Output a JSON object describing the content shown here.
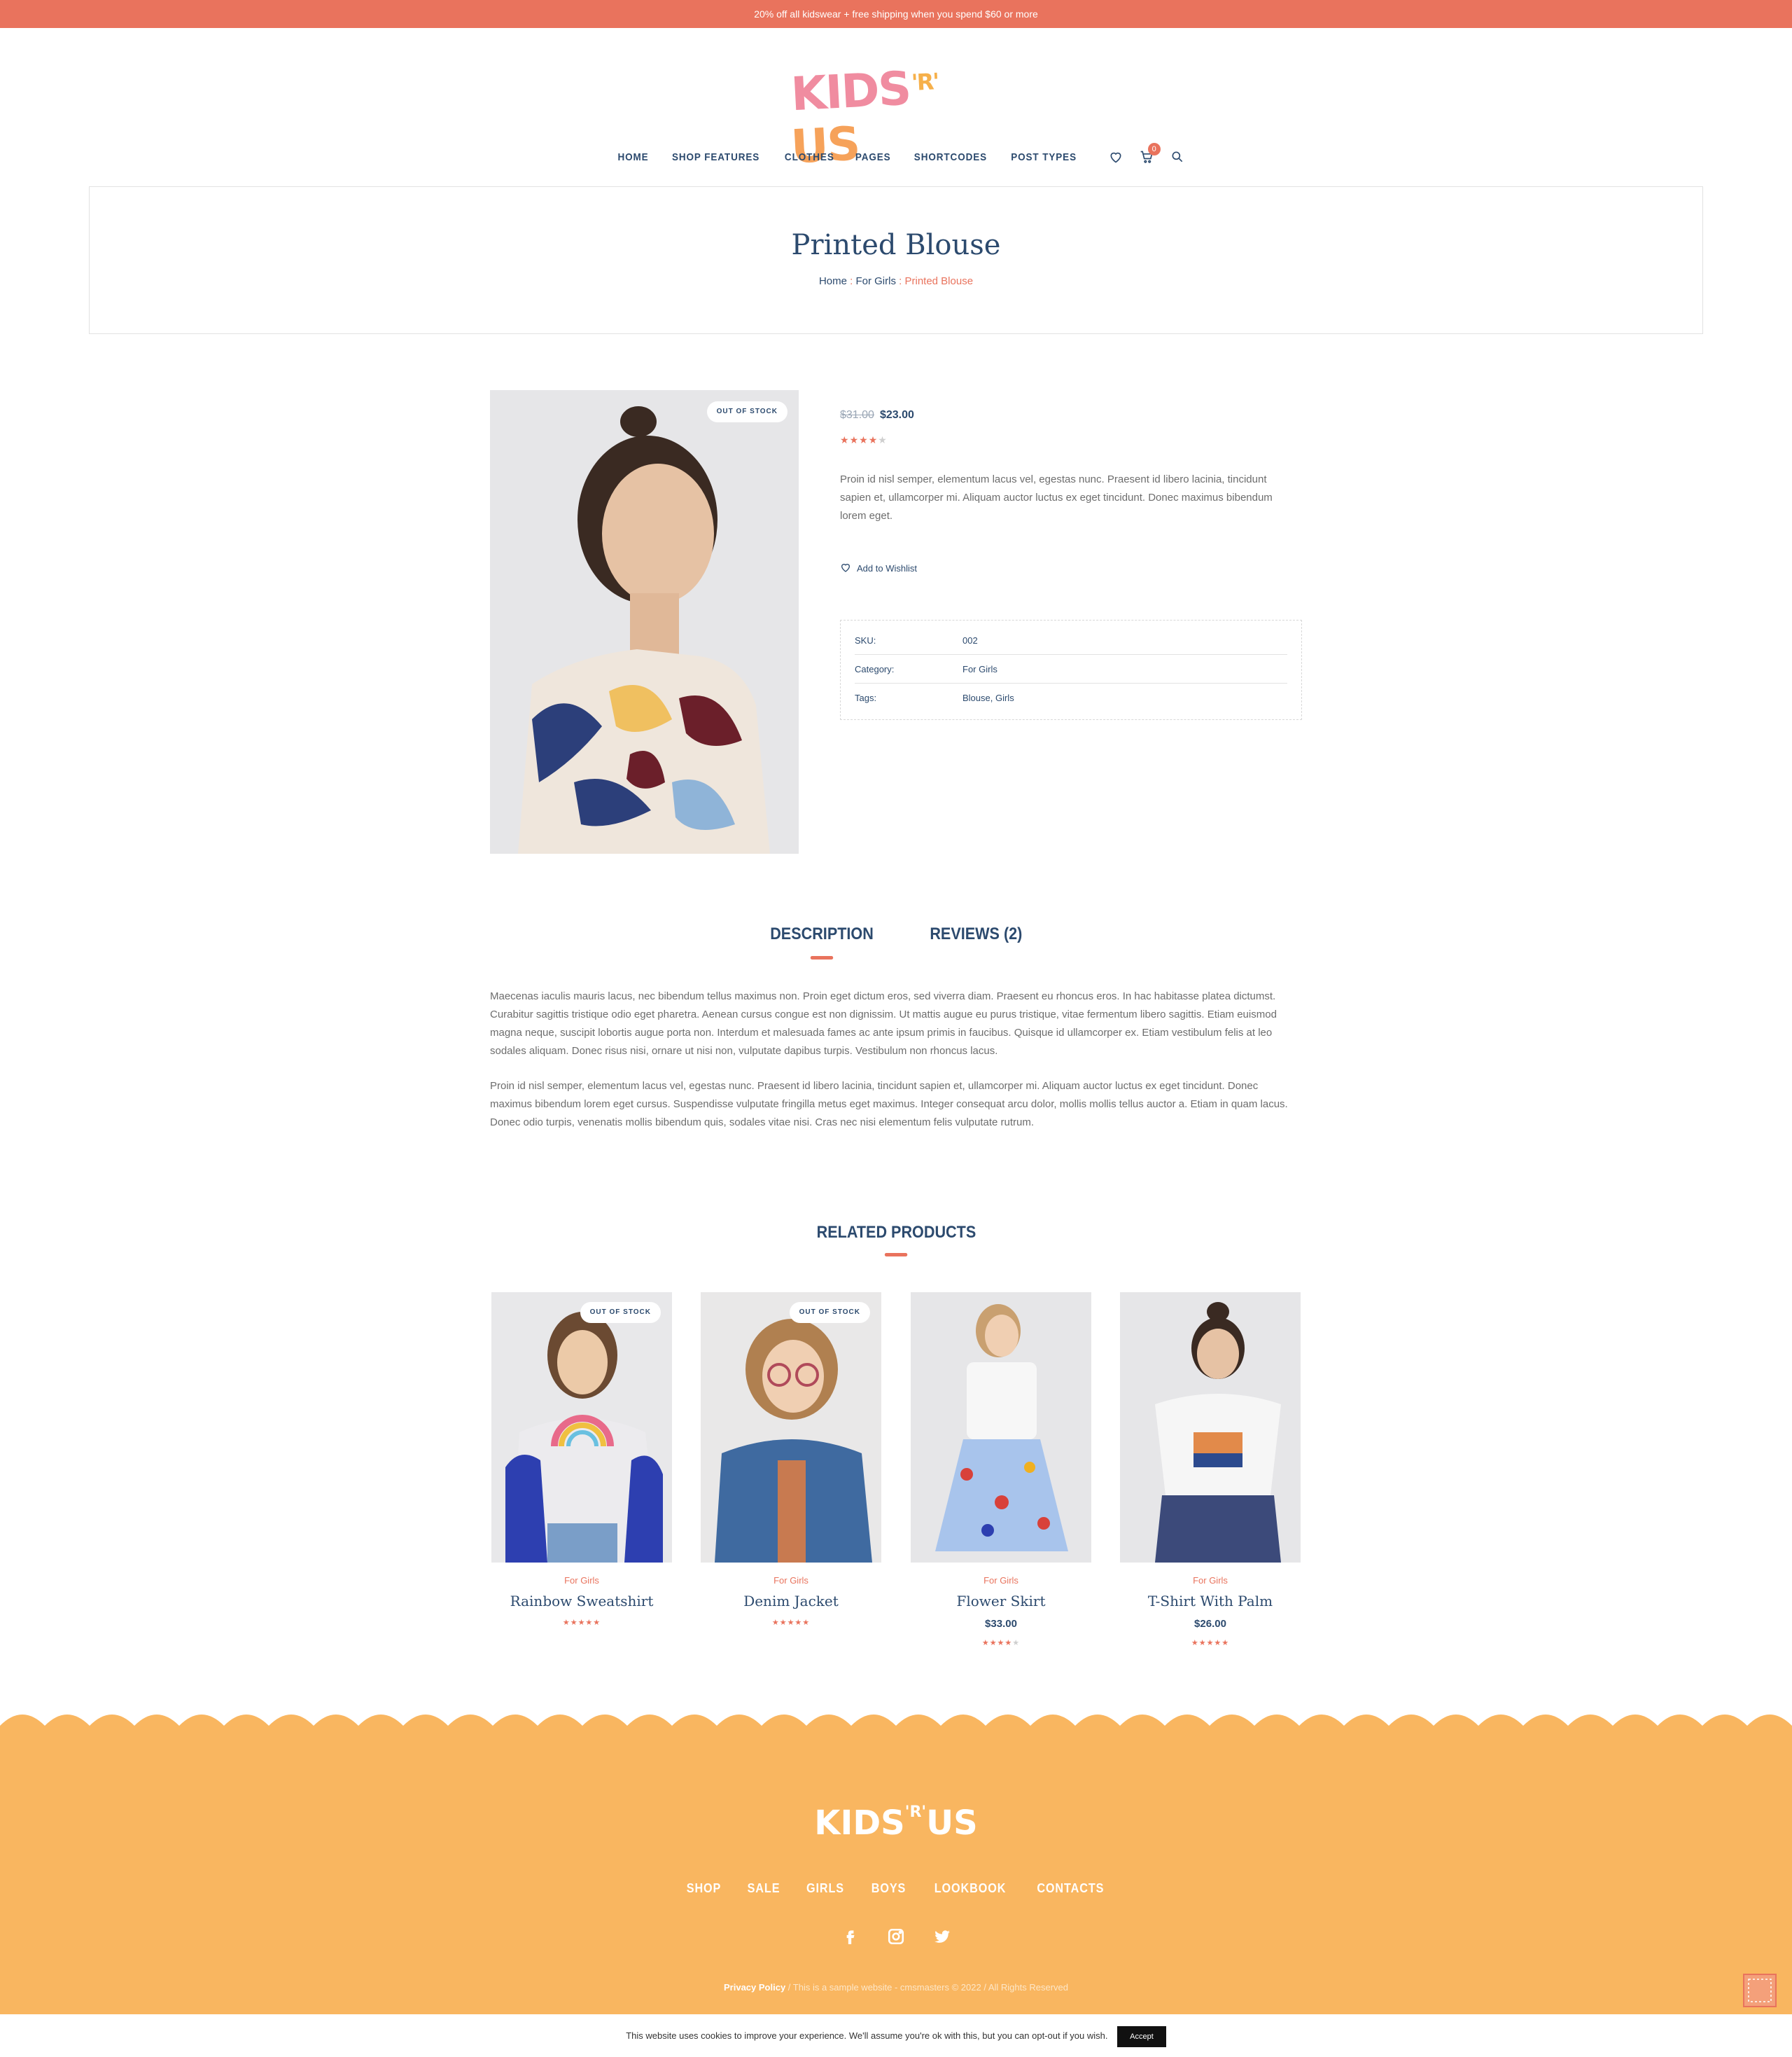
{
  "topbar": {
    "text": "20% off all kidswear + free shipping when you spend $60 or more"
  },
  "logo": {
    "part1": "KIDS",
    "part2": "'R'",
    "part3": "US"
  },
  "nav": {
    "items": [
      "HOME",
      "SHOP FEATURES",
      "CLOTHES",
      "PAGES",
      "SHORTCODES",
      "POST TYPES"
    ],
    "cart_count": "0"
  },
  "page": {
    "title": "Printed Blouse",
    "breadcrumb": {
      "home": "Home",
      "sep": " : ",
      "category": "For Girls",
      "current": "Printed Blouse"
    }
  },
  "product": {
    "badge": "OUT OF STOCK",
    "old_price": "$31.00",
    "price": "$23.00",
    "rating": 4,
    "short_description": "Proin id nisl semper, elementum lacus vel, egestas nunc. Praesent id libero lacinia, tincidunt sapien et, ullamcorper mi. Aliquam auctor luctus ex eget tincidunt. Donec maximus bibendum lorem eget.",
    "wishlist_label": "Add to Wishlist",
    "meta": [
      {
        "key": "SKU:",
        "value": "002"
      },
      {
        "key": "Category:",
        "value": "For Girls"
      },
      {
        "key": "Tags:",
        "value": "Blouse, Girls"
      }
    ]
  },
  "tabs": {
    "description": "DESCRIPTION",
    "reviews": "REVIEWS (2)"
  },
  "description": {
    "p1": "Maecenas iaculis mauris lacus, nec bibendum tellus maximus non. Proin eget dictum eros, sed viverra diam. Praesent eu rhoncus eros. In hac habitasse platea dictumst. Curabitur sagittis tristique odio eget pharetra. Aenean cursus congue est non dignissim. Ut mattis augue eu purus tristique, vitae fermentum libero sagittis. Etiam euismod magna neque, suscipit lobortis augue porta non. Interdum et malesuada fames ac ante ipsum primis in faucibus. Quisque id ullamcorper ex. Etiam vestibulum felis at leo sodales aliquam. Donec risus nisi, ornare ut nisi non, vulputate dapibus turpis. Vestibulum non rhoncus lacus.",
    "p2": "Proin id nisl semper, elementum lacus vel, egestas nunc. Praesent id libero lacinia, tincidunt sapien et, ullamcorper mi. Aliquam auctor luctus ex eget tincidunt. Donec maximus bibendum lorem eget cursus. Suspendisse vulputate fringilla metus eget maximus. Integer consequat arcu dolor, mollis mollis tellus auctor a. Etiam in quam lacus. Donec odio turpis, venenatis mollis bibendum quis, sodales vitae nisi. Cras nec nisi elementum felis vulputate rutrum."
  },
  "related": {
    "title": "RELATED PRODUCTS",
    "products": [
      {
        "category": "For Girls",
        "name": "Rainbow Sweatshirt",
        "price": "",
        "rating": 5,
        "badge": "OUT OF STOCK"
      },
      {
        "category": "For Girls",
        "name": "Denim Jacket",
        "price": "",
        "rating": 5,
        "badge": "OUT OF STOCK"
      },
      {
        "category": "For Girls",
        "name": "Flower Skirt",
        "price": "$33.00",
        "rating": 4,
        "badge": ""
      },
      {
        "category": "For Girls",
        "name": "T-Shirt With Palm",
        "price": "$26.00",
        "rating": 5,
        "badge": ""
      }
    ]
  },
  "footer": {
    "nav": [
      "SHOP",
      "SALE",
      "GIRLS",
      "BOYS",
      "LOOKBOOK",
      "CONTACTS"
    ],
    "social": [
      "facebook-icon",
      "instagram-icon",
      "twitter-icon"
    ],
    "privacy": "Privacy Policy",
    "copyright": " / This is a sample website - cmsmasters © 2022 / All Rights Reserved"
  },
  "cookie": {
    "text": "This website uses cookies to improve your experience. We'll assume you're ok with this, but you can opt-out if you wish.",
    "accept": "Accept"
  },
  "colors": {
    "accent": "#e9735d",
    "navy": "#2c4a6e",
    "footer": "#f9b660"
  }
}
